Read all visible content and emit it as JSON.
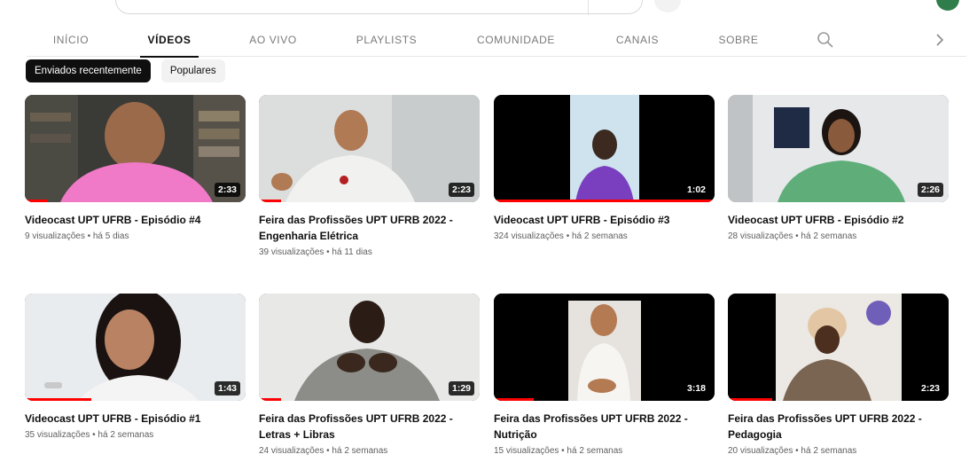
{
  "tabs": [
    {
      "label": "INÍCIO",
      "active": false
    },
    {
      "label": "VÍDEOS",
      "active": true
    },
    {
      "label": "AO VIVO",
      "active": false
    },
    {
      "label": "PLAYLISTS",
      "active": false
    },
    {
      "label": "COMUNIDADE",
      "active": false
    },
    {
      "label": "CANAIS",
      "active": false
    },
    {
      "label": "SOBRE",
      "active": false
    }
  ],
  "icons": {
    "tab_search": "search-icon",
    "tab_next": "chevron-right-icon"
  },
  "chips": [
    {
      "label": "Enviados recentemente",
      "active": true
    },
    {
      "label": "Populares",
      "active": false
    }
  ],
  "videos": [
    {
      "title": "Videocast UPT UFRB - Episódio #4",
      "meta": "9 visualizações • há 5 dias",
      "duration": "2:33",
      "progress": 0.1
    },
    {
      "title": "Feira das Profissões UPT UFRB 2022 - Engenharia Elétrica",
      "meta": "39 visualizações • há 11 dias",
      "duration": "2:23",
      "progress": 0.1
    },
    {
      "title": "Videocast UPT UFRB - Episódio #3",
      "meta": "324 visualizações • há 2 semanas",
      "duration": "1:02",
      "progress": 1.0
    },
    {
      "title": "Videocast UPT UFRB - Episódio #2",
      "meta": "28 visualizações • há 2 semanas",
      "duration": "2:26",
      "progress": 0.0
    },
    {
      "title": "Videocast UPT UFRB - Episódio #1",
      "meta": "35 visualizações • há 2 semanas",
      "duration": "1:43",
      "progress": 0.3
    },
    {
      "title": "Feira das Profissões UPT UFRB 2022 - Letras + Libras",
      "meta": "24 visualizações • há 2 semanas",
      "duration": "1:29",
      "progress": 0.1
    },
    {
      "title": "Feira das Profissões UPT UFRB 2022 - Nutrição",
      "meta": "15 visualizações • há 2 semanas",
      "duration": "3:18",
      "progress": 0.18
    },
    {
      "title": "Feira das Profissões UPT UFRB 2022 - Pedagogia",
      "meta": "20 visualizações • há 2 semanas",
      "duration": "2:23",
      "progress": 0.2
    }
  ],
  "colors": {
    "accent": "#ff0000",
    "text": "#0f0f0f",
    "muted": "#606060",
    "chip_active": "#0f0f0f",
    "chip_bg": "#f2f2f2"
  }
}
